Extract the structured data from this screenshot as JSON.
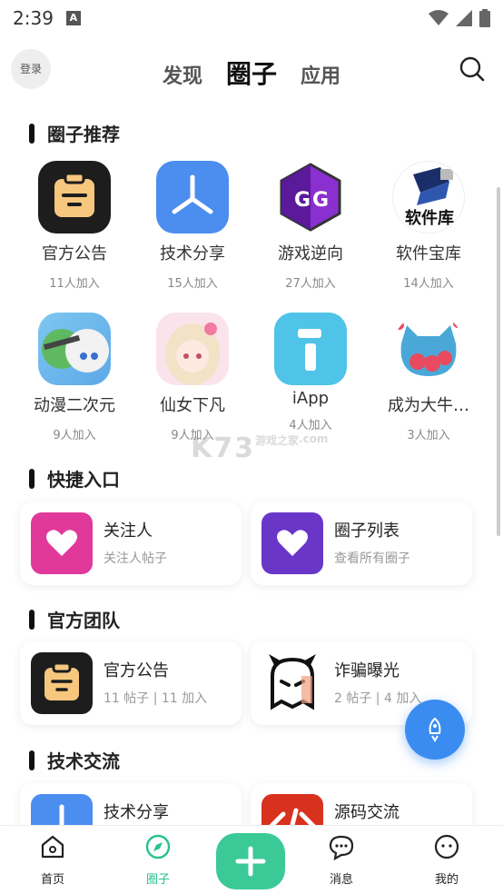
{
  "status_bar": {
    "time": "2:39",
    "app_icon_letter": "A"
  },
  "header": {
    "login_label": "登录",
    "tabs": [
      {
        "label": "发现"
      },
      {
        "label": "圈子"
      },
      {
        "label": "应用"
      }
    ],
    "active_tab": "圈子",
    "search_icon": "search-icon"
  },
  "sections": {
    "recommend": {
      "title": "圈子推荐",
      "items": [
        {
          "name": "官方公告",
          "count": "11人加入",
          "icon": "clipboard-icon"
        },
        {
          "name": "技术分享",
          "count": "15人加入",
          "icon": "tri-branch-icon"
        },
        {
          "name": "游戏逆向",
          "count": "27人加入",
          "icon": "gg-icon"
        },
        {
          "name": "软件宝库",
          "count": "14人加入",
          "icon": "software-library-icon",
          "icon_text": "软件库"
        },
        {
          "name": "动漫二次元",
          "count": "9人加入",
          "icon": "anime-avatar-icon"
        },
        {
          "name": "仙女下凡",
          "count": "9人加入",
          "icon": "fairy-avatar-icon"
        },
        {
          "name": "iApp",
          "count": "4人加入",
          "icon": "iapp-icon"
        },
        {
          "name": "成为大牛…",
          "count": "3人加入",
          "icon": "cat-hearts-icon"
        }
      ]
    },
    "shortcuts": {
      "title": "快捷入口",
      "items": [
        {
          "title": "关注人",
          "subtitle": "关注人帖子",
          "icon": "heart-icon",
          "color": "#e0399a"
        },
        {
          "title": "圈子列表",
          "subtitle": "查看所有圈子",
          "icon": "heart-icon",
          "color": "#6a36c8"
        }
      ]
    },
    "team": {
      "title": "官方团队",
      "items": [
        {
          "title": "官方公告",
          "subtitle": "11 帖子 | 11 加入",
          "icon": "clipboard-icon"
        },
        {
          "title": "诈骗曝光",
          "subtitle": "2 帖子 | 4 加入",
          "icon": "devil-icon"
        }
      ]
    },
    "tech": {
      "title": "技术交流",
      "items": [
        {
          "title": "技术分享",
          "icon": "tri-branch-icon"
        },
        {
          "title": "源码交流",
          "icon": "code-icon"
        }
      ]
    }
  },
  "watermark": {
    "text": "K73",
    "sub": "游戏之家",
    "domain": ".com"
  },
  "bottom_nav": {
    "items": [
      {
        "label": "首页",
        "icon": "home-icon"
      },
      {
        "label": "圈子",
        "icon": "compass-icon"
      },
      {
        "label": "消息",
        "icon": "chat-icon"
      },
      {
        "label": "我的",
        "icon": "profile-face-icon"
      }
    ],
    "active": "圈子",
    "plus_icon": "plus-icon"
  },
  "colors": {
    "accent_green": "#3cc998",
    "fab_blue": "#3a8cf0",
    "nav_active": "#27c290"
  }
}
